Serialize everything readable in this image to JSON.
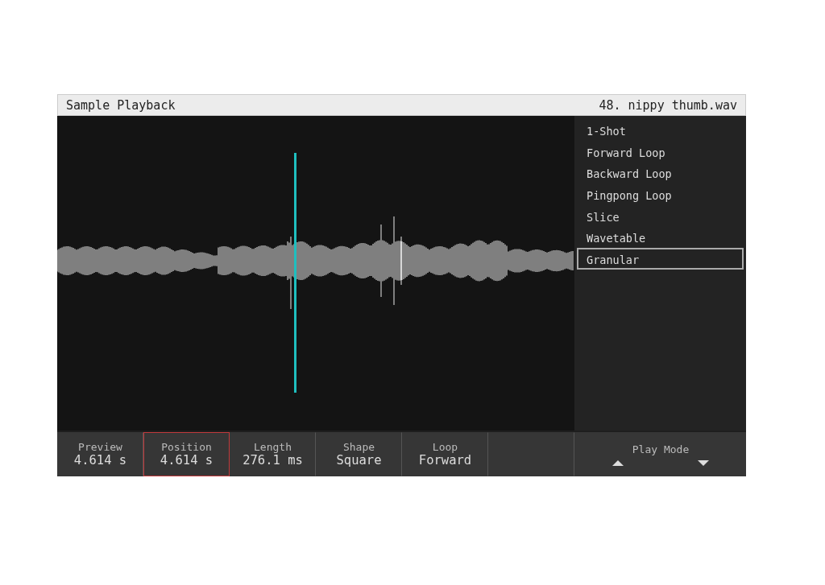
{
  "header": {
    "title": "Sample Playback",
    "file": "48. nippy thumb.wav"
  },
  "modes": [
    {
      "label": "1-Shot",
      "selected": false
    },
    {
      "label": "Forward Loop",
      "selected": false
    },
    {
      "label": "Backward Loop",
      "selected": false
    },
    {
      "label": "Pingpong Loop",
      "selected": false
    },
    {
      "label": "Slice",
      "selected": false
    },
    {
      "label": "Wavetable",
      "selected": false
    },
    {
      "label": "Granular",
      "selected": true
    }
  ],
  "params": [
    {
      "kind": "value",
      "label": "Preview",
      "value": "4.614 s",
      "selected": false
    },
    {
      "kind": "value",
      "label": "Position",
      "value": "4.614 s",
      "selected": true
    },
    {
      "kind": "value",
      "label": "Length",
      "value": "276.1 ms",
      "selected": false
    },
    {
      "kind": "value",
      "label": "Shape",
      "value": "Square",
      "selected": false
    },
    {
      "kind": "value",
      "label": "Loop",
      "value": "Forward",
      "selected": false
    },
    {
      "kind": "empty"
    },
    {
      "kind": "arrows",
      "label": "Play Mode",
      "selected": false
    }
  ]
}
